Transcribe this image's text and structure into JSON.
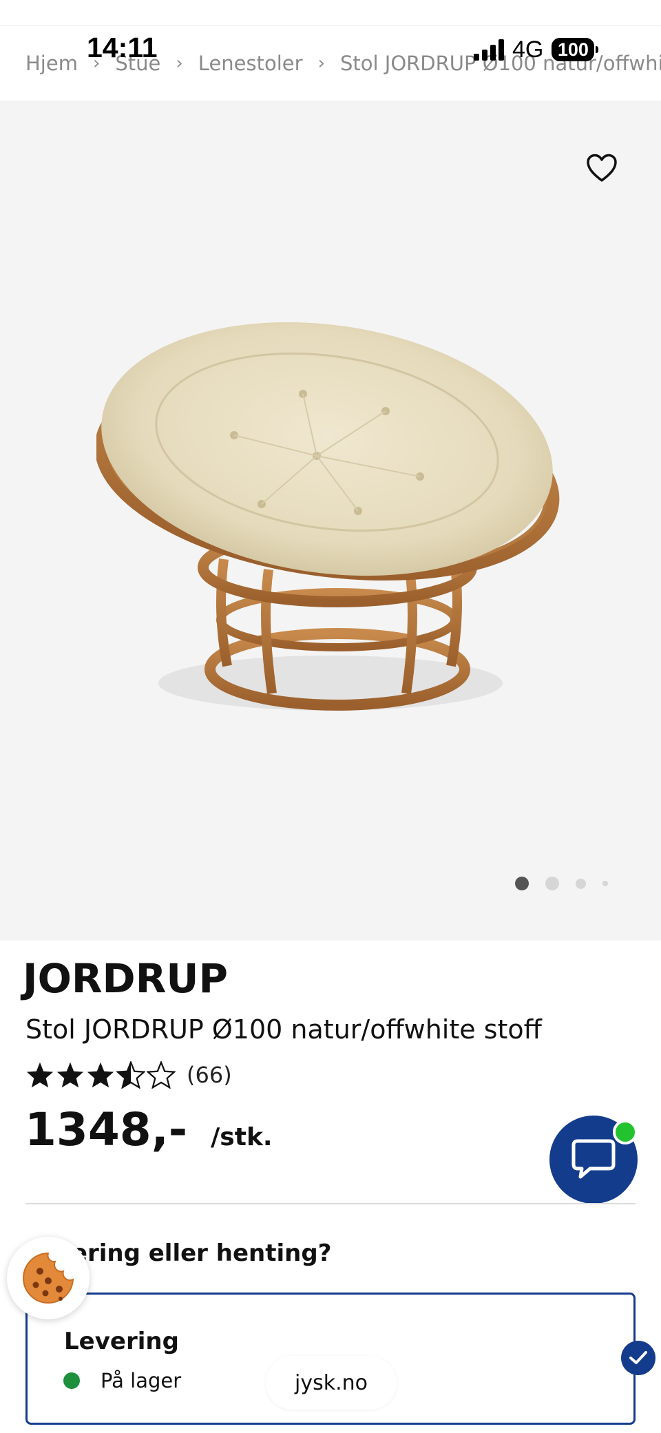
{
  "status_bar": {
    "time": "14:11",
    "network": "4G",
    "battery": "100"
  },
  "breadcrumb": {
    "items": [
      "Hjem",
      "Stue",
      "Lenestoler",
      "Stol JORDRUP Ø100 natur/offwhi"
    ],
    "separator": "›"
  },
  "gallery": {
    "favorite_icon": "heart-outline-icon",
    "image": "rattan papasan chair with beige cushion",
    "slide_count": 4,
    "active_slide": 1
  },
  "product": {
    "brand": "JORDRUP",
    "name": "Stol JORDRUP Ø100 natur/offwhite stoff",
    "rating": 3.5,
    "rating_max": 5,
    "rating_count": "(66)",
    "price": "1348,-",
    "unit": "/stk."
  },
  "chat": {
    "icon": "chat-bubble-icon",
    "online": true
  },
  "fulfillment": {
    "question": "Levering eller henting?",
    "option_title": "Levering",
    "stock_status": "På lager",
    "selected": true
  },
  "cookie": {
    "icon": "cookie-icon"
  },
  "browser": {
    "url": "jysk.no"
  },
  "colors": {
    "brand_blue": "#143c8c",
    "in_stock_green": "#1e8f3c",
    "online_green": "#22c32e",
    "gallery_bg": "#f4f4f4"
  }
}
